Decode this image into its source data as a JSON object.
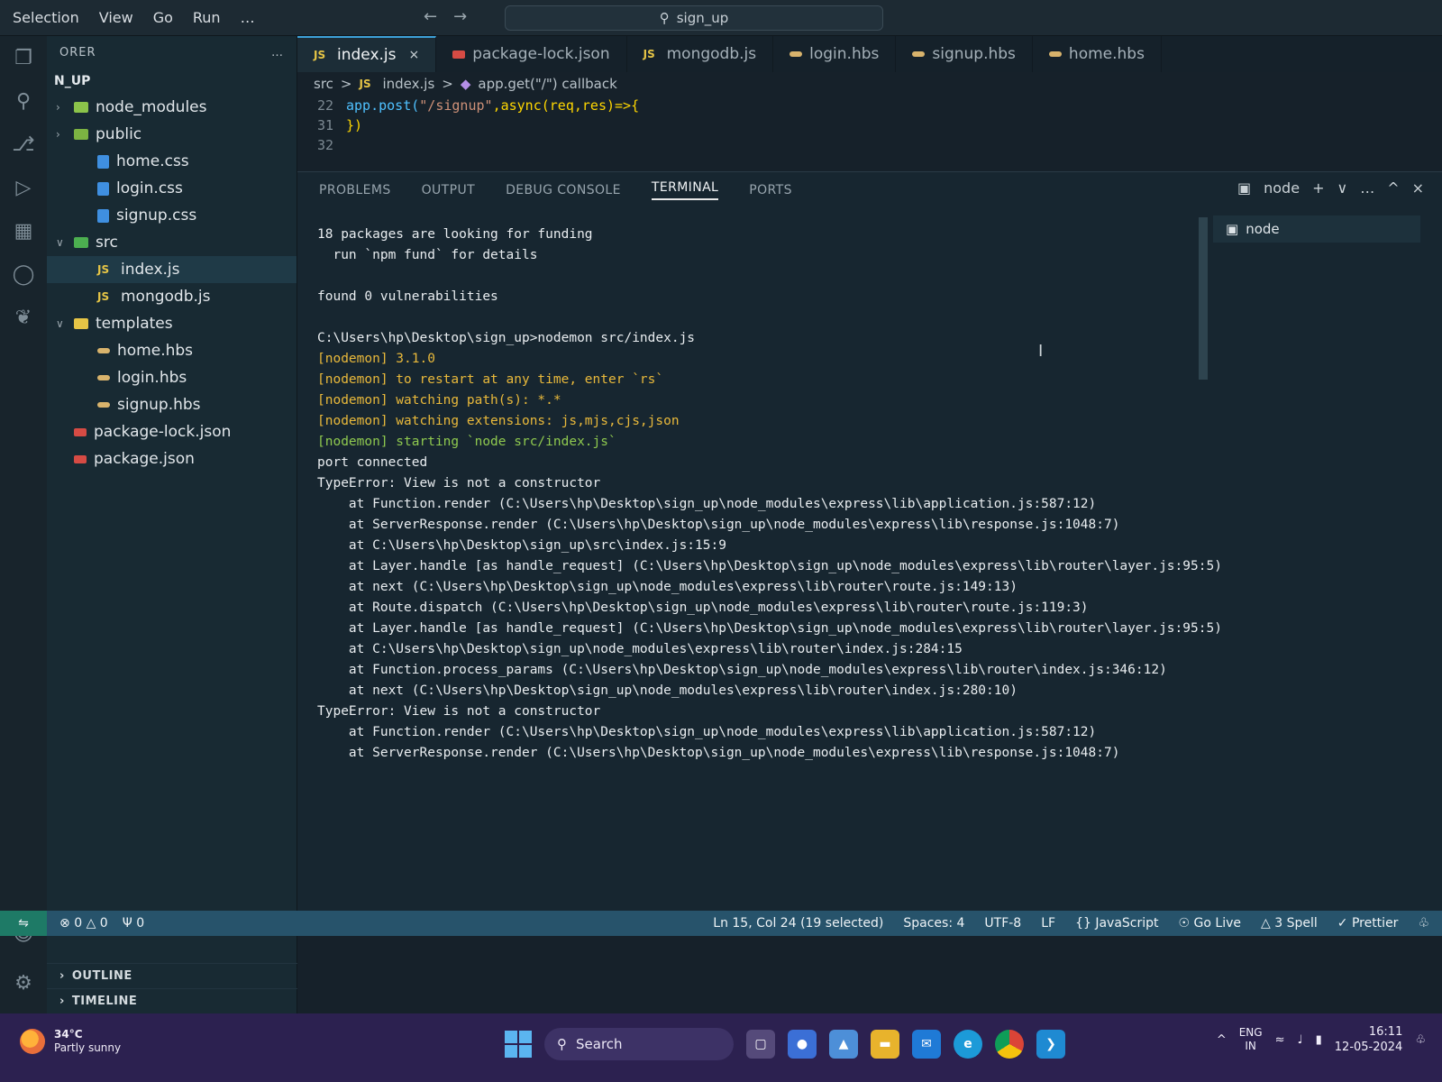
{
  "menubar": {
    "items": [
      "Selection",
      "View",
      "Go",
      "Run",
      "…"
    ],
    "command_center": "sign_up"
  },
  "sidebar": {
    "header": "ORER",
    "more": "…",
    "project": "N_UP",
    "tree": [
      {
        "label": "node_modules",
        "type": "folder",
        "depth": 0,
        "color": "#8bc34a"
      },
      {
        "label": "public",
        "type": "folder",
        "depth": 0,
        "color": "#7cb342"
      },
      {
        "label": "home.css",
        "type": "css",
        "depth": 1
      },
      {
        "label": "login.css",
        "type": "css",
        "depth": 1
      },
      {
        "label": "signup.css",
        "type": "css",
        "depth": 1
      },
      {
        "label": "src",
        "type": "folder",
        "depth": 0,
        "color": "#4caf50",
        "expanded": true
      },
      {
        "label": "index.js",
        "type": "js",
        "depth": 1,
        "active": true
      },
      {
        "label": "mongodb.js",
        "type": "js",
        "depth": 1
      },
      {
        "label": "templates",
        "type": "folder",
        "depth": 0,
        "color": "#e6c546",
        "expanded": true
      },
      {
        "label": "home.hbs",
        "type": "hbs",
        "depth": 1
      },
      {
        "label": "login.hbs",
        "type": "hbs",
        "depth": 1
      },
      {
        "label": "signup.hbs",
        "type": "hbs",
        "depth": 1
      },
      {
        "label": "package-lock.json",
        "type": "json",
        "depth": 0
      },
      {
        "label": "package.json",
        "type": "json",
        "depth": 0
      }
    ],
    "sections": [
      "OUTLINE",
      "TIMELINE"
    ]
  },
  "editor": {
    "tabs": [
      {
        "label": "index.js",
        "icon": "JS",
        "active": true,
        "close": "×"
      },
      {
        "label": "package-lock.json",
        "icon": "json"
      },
      {
        "label": "mongodb.js",
        "icon": "JS"
      },
      {
        "label": "login.hbs",
        "icon": "hbs"
      },
      {
        "label": "signup.hbs",
        "icon": "hbs"
      },
      {
        "label": "home.hbs",
        "icon": "hbs"
      }
    ],
    "breadcrumb": [
      "src",
      ">",
      "index.js",
      ">",
      "app.get(\"/\") callback"
    ],
    "lines": [
      {
        "num": "22",
        "code_kw": "app.post(",
        "code_str": "\"/signup\"",
        "code_rest": ",async(req,res)=>{"
      },
      {
        "num": "31",
        "code_kw": "",
        "code_str": "",
        "code_rest": "})"
      },
      {
        "num": "32",
        "code_kw": "",
        "code_str": "",
        "code_rest": ""
      }
    ]
  },
  "panel": {
    "tabs": [
      "PROBLEMS",
      "OUTPUT",
      "DEBUG CONSOLE",
      "TERMINAL",
      "PORTS"
    ],
    "active_tab": "TERMINAL",
    "actions": [
      "node",
      "+",
      "∨",
      "…",
      "^",
      "×"
    ],
    "terminal_instance": "node"
  },
  "terminal": {
    "lines": [
      {
        "text": "18 packages are looking for funding",
        "style": "plain"
      },
      {
        "text": "  run `npm fund` for details",
        "style": "plain"
      },
      {
        "text": "",
        "style": "plain"
      },
      {
        "text": "found 0 vulnerabilities",
        "style": "plain"
      },
      {
        "text": "",
        "style": "plain"
      },
      {
        "text": "C:\\Users\\hp\\Desktop\\sign_up>nodemon src/index.js",
        "style": "plain"
      },
      {
        "text": "[nodemon] 3.1.0",
        "style": "yellow"
      },
      {
        "text": "[nodemon] to restart at any time, enter `rs`",
        "style": "yellow"
      },
      {
        "text": "[nodemon] watching path(s): *.*",
        "style": "yellow"
      },
      {
        "text": "[nodemon] watching extensions: js,mjs,cjs,json",
        "style": "yellow"
      },
      {
        "text": "[nodemon] starting `node src/index.js`",
        "style": "green"
      },
      {
        "text": "port connected",
        "style": "plain"
      },
      {
        "text": "TypeError: View is not a constructor",
        "style": "plain"
      },
      {
        "text": "    at Function.render (C:\\Users\\hp\\Desktop\\sign_up\\node_modules\\express\\lib\\application.js:587:12)",
        "style": "plain"
      },
      {
        "text": "    at ServerResponse.render (C:\\Users\\hp\\Desktop\\sign_up\\node_modules\\express\\lib\\response.js:1048:7)",
        "style": "plain"
      },
      {
        "text": "    at C:\\Users\\hp\\Desktop\\sign_up\\src\\index.js:15:9",
        "style": "plain"
      },
      {
        "text": "    at Layer.handle [as handle_request] (C:\\Users\\hp\\Desktop\\sign_up\\node_modules\\express\\lib\\router\\layer.js:95:5)",
        "style": "plain"
      },
      {
        "text": "    at next (C:\\Users\\hp\\Desktop\\sign_up\\node_modules\\express\\lib\\router\\route.js:149:13)",
        "style": "plain"
      },
      {
        "text": "    at Route.dispatch (C:\\Users\\hp\\Desktop\\sign_up\\node_modules\\express\\lib\\router\\route.js:119:3)",
        "style": "plain"
      },
      {
        "text": "    at Layer.handle [as handle_request] (C:\\Users\\hp\\Desktop\\sign_up\\node_modules\\express\\lib\\router\\layer.js:95:5)",
        "style": "plain"
      },
      {
        "text": "    at C:\\Users\\hp\\Desktop\\sign_up\\node_modules\\express\\lib\\router\\index.js:284:15",
        "style": "plain"
      },
      {
        "text": "    at Function.process_params (C:\\Users\\hp\\Desktop\\sign_up\\node_modules\\express\\lib\\router\\index.js:346:12)",
        "style": "plain"
      },
      {
        "text": "    at next (C:\\Users\\hp\\Desktop\\sign_up\\node_modules\\express\\lib\\router\\index.js:280:10)",
        "style": "plain"
      },
      {
        "text": "TypeError: View is not a constructor",
        "style": "plain"
      },
      {
        "text": "    at Function.render (C:\\Users\\hp\\Desktop\\sign_up\\node_modules\\express\\lib\\application.js:587:12)",
        "style": "plain"
      },
      {
        "text": "    at ServerResponse.render (C:\\Users\\hp\\Desktop\\sign_up\\node_modules\\express\\lib\\response.js:1048:7)",
        "style": "plain"
      }
    ]
  },
  "statusbar": {
    "errors": "0",
    "warnings": "0",
    "ports": "0",
    "position": "Ln 15, Col 24 (19 selected)",
    "spaces": "Spaces: 4",
    "encoding": "UTF-8",
    "eol": "LF",
    "language": "{} JavaScript",
    "golive": "Go Live",
    "spell": "3 Spell",
    "prettier": "Prettier"
  },
  "taskbar": {
    "weather_temp": "34°C",
    "weather_desc": "Partly sunny",
    "search": "Search",
    "lang_top": "ENG",
    "lang_bottom": "IN",
    "time": "16:11",
    "date": "12-05-2024"
  },
  "colors": {
    "accent": "#3da0d8",
    "statusbar": "#27536b",
    "nodemon_yellow": "#e9b93b",
    "nodemon_green": "#8fc94f",
    "taskbar": "#2c2150"
  }
}
